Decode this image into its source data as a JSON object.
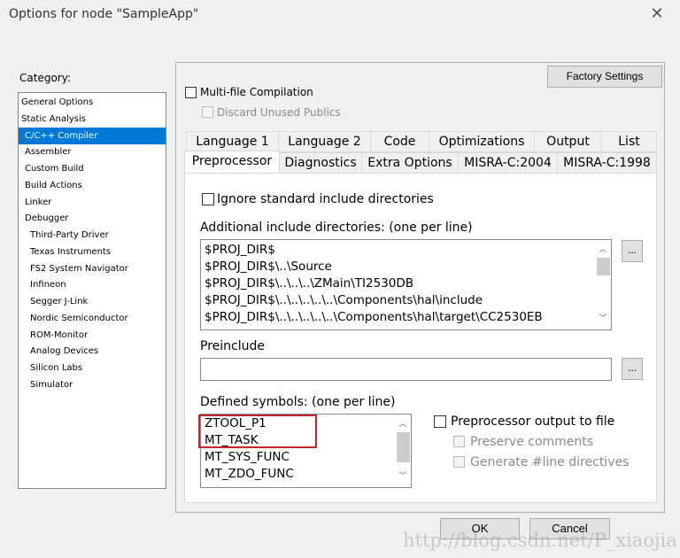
{
  "window": {
    "title": "Options for node \"SampleApp\"",
    "close": "✕"
  },
  "category": {
    "label": "Category:",
    "items": [
      {
        "label": "General Options",
        "level": 0
      },
      {
        "label": "Static Analysis",
        "level": 0
      },
      {
        "label": "C/C++ Compiler",
        "level": 1,
        "selected": true
      },
      {
        "label": "Assembler",
        "level": 1
      },
      {
        "label": "Custom Build",
        "level": 1
      },
      {
        "label": "Build Actions",
        "level": 1
      },
      {
        "label": "Linker",
        "level": 1
      },
      {
        "label": "Debugger",
        "level": 1
      },
      {
        "label": "Third-Party Driver",
        "level": 2
      },
      {
        "label": "Texas Instruments",
        "level": 2
      },
      {
        "label": "FS2 System Navigator",
        "level": 2
      },
      {
        "label": "Infineon",
        "level": 2
      },
      {
        "label": "Segger J-Link",
        "level": 2
      },
      {
        "label": "Nordic Semiconductor",
        "level": 2
      },
      {
        "label": "ROM-Monitor",
        "level": 2
      },
      {
        "label": "Analog Devices",
        "level": 2
      },
      {
        "label": "Silicon Labs",
        "level": 2
      },
      {
        "label": "Simulator",
        "level": 2
      }
    ]
  },
  "factory_settings": "Factory Settings",
  "multi_file": {
    "label": "Multi-file Compilation",
    "checked": false
  },
  "discard_unused": {
    "label": "Discard Unused Publics",
    "checked": false,
    "disabled": true
  },
  "tabs_row1": [
    "Language 1",
    "Language 2",
    "Code",
    "Optimizations",
    "Output",
    "List"
  ],
  "tabs_row2": [
    "Preprocessor",
    "Diagnostics",
    "Extra Options",
    "MISRA-C:2004",
    "MISRA-C:1998"
  ],
  "active_tab": "Preprocessor",
  "ignore_std": {
    "label": "Ignore standard include directories",
    "checked": false
  },
  "include_dirs": {
    "label": "Additional include directories: (one per line)",
    "lines": [
      "$PROJ_DIR$",
      "$PROJ_DIR$\\..\\Source",
      "$PROJ_DIR$\\..\\..\\..\\ZMain\\TI2530DB",
      "$PROJ_DIR$\\..\\..\\..\\..\\..\\Components\\hal\\include",
      "$PROJ_DIR$\\..\\..\\..\\..\\..\\Components\\hal\\target\\CC2530EB"
    ]
  },
  "browse": "...",
  "preinclude": {
    "label": "Preinclude",
    "value": ""
  },
  "defined_symbols": {
    "label": "Defined symbols: (one per line)",
    "lines": [
      "ZTOOL_P1",
      "MT_TASK",
      "MT_SYS_FUNC",
      "MT_ZDO_FUNC"
    ],
    "highlight_color": "#c0282d"
  },
  "pp_output": {
    "label": "Preprocessor output to file",
    "checked": false
  },
  "preserve_comments": {
    "label": "Preserve comments",
    "checked": false,
    "disabled": true
  },
  "generate_line": {
    "label": "Generate #line directives",
    "checked": false,
    "disabled": true
  },
  "ok": "OK",
  "cancel": "Cancel",
  "watermark": "http://blog.csdn.net/P_xiaojia",
  "accent": "#0078d7"
}
